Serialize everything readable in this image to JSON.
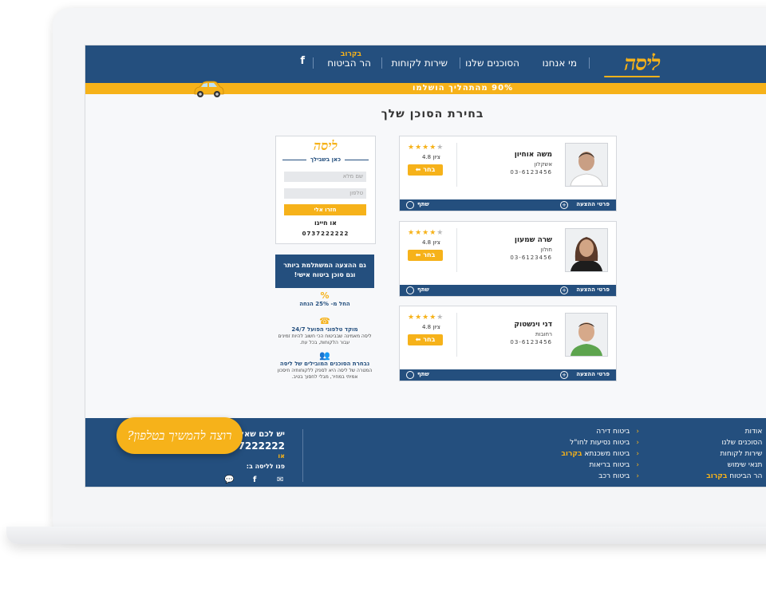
{
  "header": {
    "logo": "ליסה",
    "nav": [
      "מי אנחנו",
      "הסוכנים שלנו",
      "שירות לקוחות",
      "הר הביטוח"
    ],
    "nav_badge": "בקרוב",
    "facebook": "f"
  },
  "progress": {
    "label": "90% מהתהליך הושלמו",
    "value": 90
  },
  "title": "בחירת הסוכן שלך",
  "agents": [
    {
      "name": "משה אוחיון",
      "city": "אשקלון",
      "phone": "03-6123456",
      "score_label": "ציון 4.8",
      "rating": 4,
      "choose": "בחר",
      "details": "פרטי ההצעה",
      "share": "שתף"
    },
    {
      "name": "שרה שמעון",
      "city": "חולון",
      "phone": "03-6123456",
      "score_label": "ציון 4.8",
      "rating": 4,
      "choose": "בחר",
      "details": "פרטי ההצעה",
      "share": "שתף"
    },
    {
      "name": "דני וינשטוק",
      "city": "רחובות",
      "phone": "03-6123456",
      "score_label": "ציון 4.8",
      "rating": 4,
      "choose": "בחר",
      "details": "פרטי ההצעה",
      "share": "שתף"
    }
  ],
  "form": {
    "logo": "ליסה",
    "tagline": "כאן בשבילך",
    "name_placeholder": "שם מלא",
    "phone_placeholder": "טלפון",
    "submit": "חזרו אלי",
    "or": "או חייגו",
    "phone": "0737222222"
  },
  "promo": {
    "line1": "גם ההצעה המשתלמת ביותר",
    "line2": "וגם סוכן ביטוח אישי!"
  },
  "features": [
    {
      "icon": "%",
      "title": "החל מ- 25% הנחה",
      "sub": ""
    },
    {
      "icon": "☎",
      "title": "מוקד טלפוני הפועל 24/7",
      "sub": "ליסה מאמינה שבביטוח הכי חשוב להיות זמינים עבור הלקוחות, בכל עת."
    },
    {
      "icon": "👥",
      "title": "נבחרת הסוכנים המובילים של ליסה",
      "sub": "המטרה של ליסה היא לספק ללקוחותיה חיסכון אמיתי במחיר, מבלי לחסוך בטיב."
    }
  ],
  "footer": {
    "col1": [
      "אודות",
      "הסוכנים שלנו",
      "שירות לקוחות",
      "תנאי שימוש",
      "הר הביטוח"
    ],
    "col2": [
      "ביטוח דירה",
      "ביטוח נסיעות לחו\"ל",
      "ביטוח משכנתא",
      "ביטוח בריאות",
      "ביטוח רכב"
    ],
    "soon": "בקרוב",
    "question": "יש לכם שאל",
    "phone": "37222222",
    "or": "או",
    "contact": "פנו לליסה ב:"
  },
  "bubble": "רוצה להמשיך בטלפון?",
  "colors": {
    "primary": "#244f7e",
    "accent": "#f6b21a"
  }
}
